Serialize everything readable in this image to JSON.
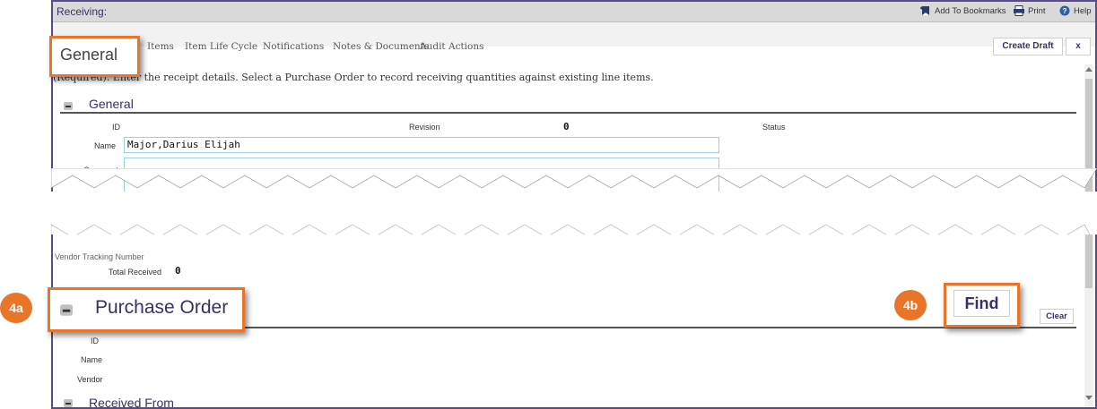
{
  "window": {
    "title": "Receiving:",
    "toolbar": {
      "bookmarks": "Add To Bookmarks",
      "print": "Print",
      "help": "Help"
    }
  },
  "tabs": [
    {
      "label": "General"
    },
    {
      "label": "Items"
    },
    {
      "label": "Item Life Cycle"
    },
    {
      "label": "Notifications"
    },
    {
      "label": "Notes & Documents"
    },
    {
      "label": "Audit Actions"
    }
  ],
  "actions": {
    "create_draft": "Create Draft",
    "close": "x"
  },
  "instructions": "(Required). Enter the receipt details. Select a Purchase Order to record receiving quantities against existing line items.",
  "general": {
    "heading": "General",
    "id_label": "ID",
    "revision_label": "Revision",
    "revision_value": "0",
    "status_label": "Status",
    "name_label": "Name",
    "name_value": "Major,Darius Elijah",
    "comment_label": "Comment"
  },
  "lower": {
    "vendor_tracking_label": "Vendor Tracking Number",
    "total_received_label": "Total Received",
    "total_received_value": "0"
  },
  "purchase_order": {
    "heading": "Purchase Order",
    "find": "Find",
    "clear": "Clear",
    "id_label": "ID",
    "name_label": "Name",
    "vendor_label": "Vendor"
  },
  "received_from": {
    "heading": "Received From"
  },
  "callouts": {
    "step_a": "4a",
    "step_b": "4b"
  },
  "colors": {
    "accent": "#e8752a",
    "frame": "#5b4a8a",
    "heading": "#3a2f66"
  }
}
